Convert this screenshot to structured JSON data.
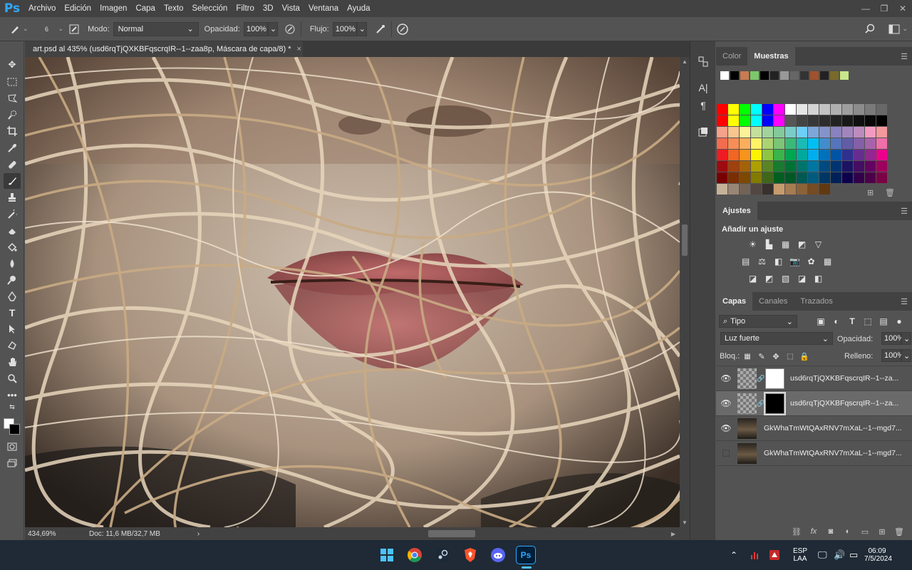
{
  "app": {
    "logo": "Ps"
  },
  "menu": [
    "Archivo",
    "Edición",
    "Imagen",
    "Capa",
    "Texto",
    "Selección",
    "Filtro",
    "3D",
    "Vista",
    "Ventana",
    "Ayuda"
  ],
  "options": {
    "brush_size": "6",
    "mode_label": "Modo:",
    "mode_value": "Normal",
    "opacity_label": "Opacidad:",
    "opacity_value": "100%",
    "flow_label": "Flujo:",
    "flow_value": "100%"
  },
  "document": {
    "tab_title": "art.psd al 435% (usd6rqTjQXKBFqscrqIR--1--zaa8p, Máscara de capa/8) *",
    "close": "×",
    "zoom": "434,69%",
    "doc_size": "Doc: 11,6 MB/32,7 MB",
    "status_arrow": "›"
  },
  "swatches_panel": {
    "tabs": [
      "Color",
      "Muestras"
    ],
    "active_tab": "Muestras",
    "recent": [
      "#ffffff",
      "#000000",
      "#c87b50",
      "#7bc86b",
      "#000000",
      "#222222",
      "#999999",
      "#666666",
      "#333333",
      "#a0522d",
      "#222222",
      "#7a6a2a",
      "#c8e68a"
    ],
    "grid": [
      [
        "#ff0000",
        "#ffff00",
        "#00ff00",
        "#00ffff",
        "#0000ff",
        "#ff00ff",
        "#ffffff",
        "#e6e6e6",
        "#d4d4d4",
        "#c2c2c2",
        "#b0b0b0",
        "#9e9e9e",
        "#8c8c8c",
        "#7a7a7a",
        "#686868"
      ],
      [
        "#ff0000",
        "#ffff00",
        "#00ff00",
        "#00ffff",
        "#0000ff",
        "#ff00ff",
        "#565656",
        "#444444",
        "#383838",
        "#2c2c2c",
        "#222222",
        "#181818",
        "#101010",
        "#080808",
        "#000000"
      ],
      [
        "#f7a08a",
        "#f9c58f",
        "#fdf29a",
        "#c4df9b",
        "#a2d39c",
        "#82ca9c",
        "#7accc8",
        "#6dcff6",
        "#7da7d9",
        "#8493ca",
        "#8882be",
        "#a186be",
        "#bc8cbf",
        "#f49ac1",
        "#f5989d"
      ],
      [
        "#f26c4f",
        "#f68e55",
        "#fbaf5c",
        "#fff467",
        "#acd372",
        "#7cc576",
        "#3bb878",
        "#1abbb4",
        "#00bff3",
        "#438ccb",
        "#5574b9",
        "#605ca8",
        "#855fa8",
        "#a763a9",
        "#f06ea9"
      ],
      [
        "#ed1c24",
        "#f26522",
        "#f7941d",
        "#fff200",
        "#8dc63f",
        "#39b54a",
        "#00a651",
        "#00a99d",
        "#00aeef",
        "#0072bc",
        "#0054a6",
        "#2e3192",
        "#662d91",
        "#92278f",
        "#ec008c"
      ],
      [
        "#9e0b0f",
        "#a0410d",
        "#a3620a",
        "#aba000",
        "#598527",
        "#197b30",
        "#007236",
        "#00746b",
        "#0076a3",
        "#004a80",
        "#003471",
        "#1b1464",
        "#440e62",
        "#630460",
        "#9e005d"
      ],
      [
        "#790000",
        "#7b2e00",
        "#7d4900",
        "#827b00",
        "#406618",
        "#005e20",
        "#005826",
        "#005952",
        "#005b7f",
        "#003663",
        "#002157",
        "#0d004c",
        "#32004b",
        "#4b0049",
        "#7b0046"
      ],
      [
        "#c7b299",
        "#998675",
        "#736357",
        "#534741",
        "#37302d",
        "#c69c6d",
        "#a67c52",
        "#8c6239",
        "#754c24",
        "#603913"
      ]
    ]
  },
  "adjustments": {
    "tab": "Ajustes",
    "title": "Añadir un ajuste",
    "row1": [
      "☀",
      "▙",
      "▦",
      "◩",
      "▽"
    ],
    "row2": [
      "▤",
      "⚖",
      "◧",
      "📷",
      "✿",
      "▦"
    ],
    "row3": [
      "◪",
      "◩",
      "▧",
      "◪",
      "◧"
    ]
  },
  "layers_panel": {
    "tabs": [
      "Capas",
      "Canales",
      "Trazados"
    ],
    "active_tab": "Capas",
    "filter_label": "Tipo",
    "blend_mode": "Luz fuerte",
    "opacity_label": "Opacidad:",
    "opacity_value": "100%",
    "lock_label": "Bloq.:",
    "fill_label": "Relleno:",
    "fill_value": "100%",
    "layers": [
      {
        "name": "usd6rqTjQXKBFqscrqIR--1--za...",
        "visible": true,
        "mask": "white"
      },
      {
        "name": "usd6rqTjQXKBFqscrqIR--1--za...",
        "visible": true,
        "mask": "black",
        "selected": true
      },
      {
        "name": "GkWhaTmWtQAxRNV7mXaL--1--mgd7...",
        "visible": true
      },
      {
        "name": "GkWhaTmWtQAxRNV7mXaL--1--mgd7...",
        "visible": false
      }
    ]
  },
  "taskbar": {
    "lang": "ESP",
    "lang_sub": "LAA",
    "time": "06:09",
    "date": "7/5/2024"
  }
}
